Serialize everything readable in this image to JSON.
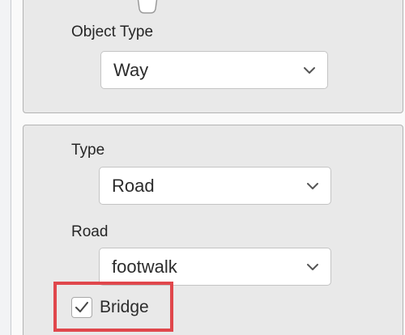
{
  "object_type": {
    "label": "Object Type",
    "selected": "Way"
  },
  "type": {
    "label": "Type",
    "selected": "Road"
  },
  "road": {
    "label": "Road",
    "selected": "footwalk"
  },
  "bridge": {
    "label": "Bridge",
    "checked": true
  },
  "icons": {
    "dropdown": "chevron-down-icon",
    "check": "checkmark-icon",
    "connector": "connector-node-icon"
  },
  "colors": {
    "highlight": "#e0474c",
    "panel_bg": "#e9e9e9",
    "field_bg": "#ffffff"
  }
}
